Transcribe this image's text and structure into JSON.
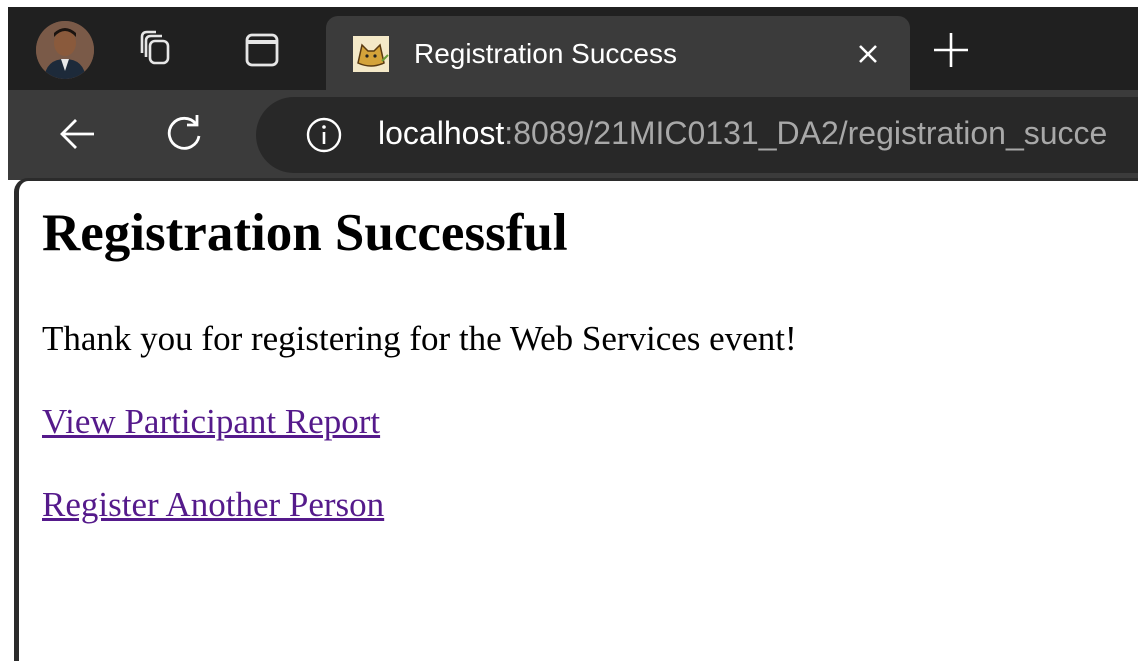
{
  "browser": {
    "tab": {
      "title": "Registration Success",
      "favicon": "tomcat-icon"
    },
    "address_bar": {
      "host": "localhost",
      "rest": ":8089/21MIC0131_DA2/registration_succe"
    },
    "colors": {
      "tabbar_bg": "#202020",
      "toolbar_bg": "#3b3b3b",
      "omnibox_bg": "#282828"
    }
  },
  "page": {
    "heading": "Registration Successful",
    "message": "Thank you for registering for the Web Services event!",
    "links": [
      {
        "label": "View Participant Report"
      },
      {
        "label": "Register Another Person"
      }
    ],
    "colors": {
      "link_visited": "#551a8b",
      "text": "#000000"
    }
  }
}
